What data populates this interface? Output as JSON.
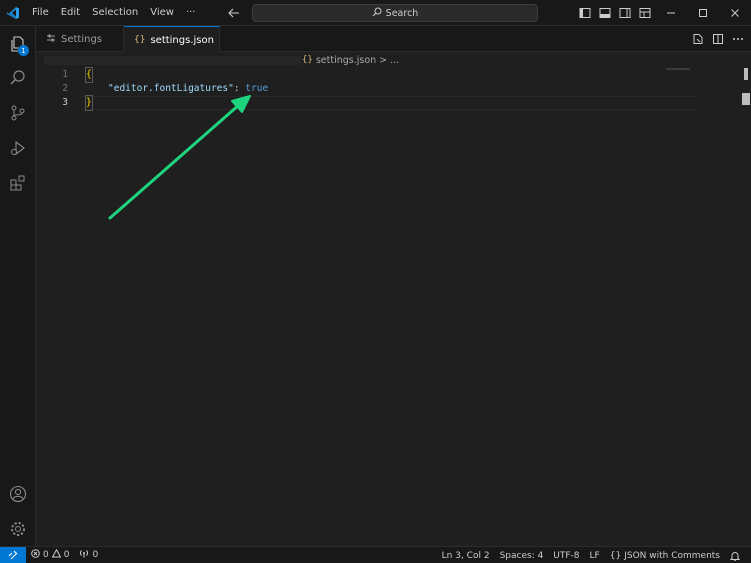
{
  "menu": [
    "File",
    "Edit",
    "Selection",
    "View",
    "···"
  ],
  "search": {
    "label": "Search"
  },
  "activity": {
    "explorer_badge": "1"
  },
  "tabs": [
    {
      "label": "Settings"
    },
    {
      "label": "settings.json",
      "icon": "{}"
    }
  ],
  "breadcrumb": {
    "icon": "{}",
    "file": "settings.json",
    "separator": ">",
    "more": "..."
  },
  "editor": {
    "lines": [
      {
        "number": "1",
        "text": "{"
      },
      {
        "number": "2",
        "key": "\"editor.fontLigatures\"",
        "colon": ": ",
        "value": "true"
      },
      {
        "number": "3",
        "text": "}"
      }
    ]
  },
  "status": {
    "errors": "0",
    "warnings": "0",
    "ports": "0",
    "position": "Ln 3, Col 2",
    "spaces": "Spaces: 4",
    "encoding": "UTF-8",
    "eol": "LF",
    "language_icon": "{}",
    "language": "JSON with Comments"
  },
  "colors": {
    "accent": "#0078d4",
    "arrow": "#1ed47f",
    "bool": "#569cd6",
    "key": "#9cdcfe",
    "brace": "#ffd700"
  }
}
